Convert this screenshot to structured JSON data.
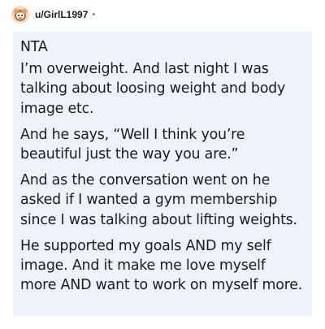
{
  "post": {
    "username": "u/GirlL1997",
    "separator": "•",
    "avatar_icon": "snoo-avatar-icon"
  },
  "comment": {
    "paragraphs": [
      "NTA",
      "I’m overweight. And last night I was talking about loosing weight and body image etc.",
      "And he says, “Well I think you’re beautiful just the way you are.”",
      "And as the conversation went on he asked if I wanted a gym membership since I was talking about lifting weights.",
      "He supported my goals AND my self image. And it make me love myself more AND want to work on myself more."
    ]
  },
  "colors": {
    "comment_background": "#eef3fb",
    "text": "#1c1c1c",
    "muted": "#7c7c7c"
  }
}
